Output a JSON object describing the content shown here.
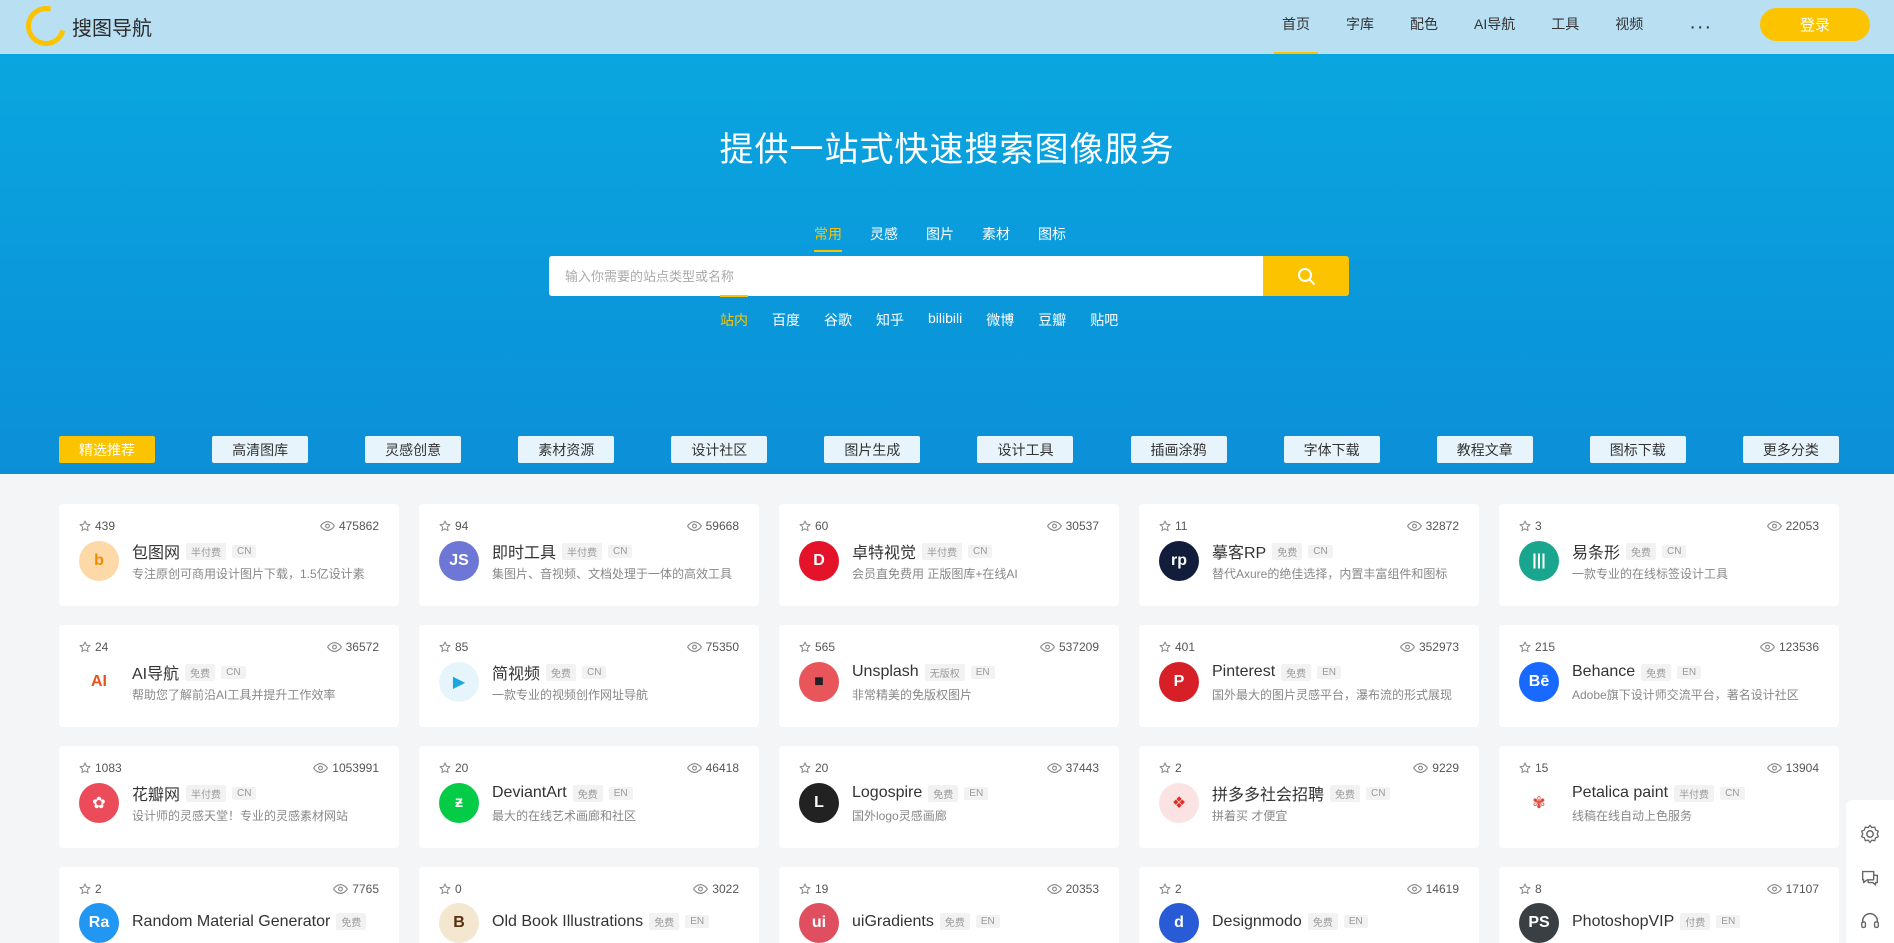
{
  "header": {
    "logo_text": "搜图导航",
    "nav": [
      "首页",
      "字库",
      "配色",
      "AI导航",
      "工具",
      "视频"
    ],
    "more": "···",
    "login": "登录"
  },
  "hero": {
    "title": "提供一站式快速搜索图像服务",
    "search_tabs": [
      "常用",
      "灵感",
      "图片",
      "素材",
      "图标"
    ],
    "search_placeholder": "输入你需要的站点类型或名称",
    "engines": [
      "站内",
      "百度",
      "谷歌",
      "知乎",
      "bilibili",
      "微博",
      "豆瓣",
      "贴吧"
    ]
  },
  "categories": [
    "精选推荐",
    "高清图库",
    "灵感创意",
    "素材资源",
    "设计社区",
    "图片生成",
    "设计工具",
    "插画涂鸦",
    "字体下载",
    "教程文章",
    "图标下载",
    "更多分类"
  ],
  "sites": [
    {
      "stars": "439",
      "views": "475862",
      "name": "包图网",
      "fee": "半付费",
      "lang": "CN",
      "desc": "专注原创可商用设计图片下载，1.5亿设计素",
      "icon": "b",
      "color": "#fdd9a8",
      "fg": "#f08a00"
    },
    {
      "stars": "94",
      "views": "59668",
      "name": "即时工具",
      "fee": "半付费",
      "lang": "CN",
      "desc": "集图片、音视频、文档处理于一体的高效工具",
      "icon": "JS",
      "color": "#6f77d6",
      "fg": "#ffffff"
    },
    {
      "stars": "60",
      "views": "30537",
      "name": "卓特视觉",
      "fee": "半付费",
      "lang": "CN",
      "desc": "会员直免费用 正版图库+在线AI",
      "icon": "D",
      "color": "#e4132a",
      "fg": "#ffffff"
    },
    {
      "stars": "11",
      "views": "32872",
      "name": "摹客RP",
      "fee": "免费",
      "lang": "CN",
      "desc": "替代Axure的绝佳选择，内置丰富组件和图标",
      "icon": "rp",
      "color": "#121c3b",
      "fg": "#ffffff"
    },
    {
      "stars": "3",
      "views": "22053",
      "name": "易条形",
      "fee": "免费",
      "lang": "CN",
      "desc": "一款专业的在线标签设计工具",
      "icon": "|||",
      "color": "#1aa58f",
      "fg": "#ffffff"
    },
    {
      "stars": "24",
      "views": "36572",
      "name": "AI导航",
      "fee": "免费",
      "lang": "CN",
      "desc": "帮助您了解前沿AI工具并提升工作效率",
      "icon": "AI",
      "color": "#ffffff",
      "fg": "#e8541e"
    },
    {
      "stars": "85",
      "views": "75350",
      "name": "简视频",
      "fee": "免费",
      "lang": "CN",
      "desc": "一款专业的视频创作网址导航",
      "icon": "▶",
      "color": "#e6f5fc",
      "fg": "#1aa6e0"
    },
    {
      "stars": "565",
      "views": "537209",
      "name": "Unsplash",
      "fee": "无版权",
      "lang": "EN",
      "desc": "非常精美的免版权图片",
      "icon": "■",
      "color": "#e8555a",
      "fg": "#222222"
    },
    {
      "stars": "401",
      "views": "352973",
      "name": "Pinterest",
      "fee": "免费",
      "lang": "EN",
      "desc": "国外最大的图片灵感平台，瀑布流的形式展现",
      "icon": "P",
      "color": "#d61f26",
      "fg": "#ffffff"
    },
    {
      "stars": "215",
      "views": "123536",
      "name": "Behance",
      "fee": "免费",
      "lang": "EN",
      "desc": "Adobe旗下设计师交流平台，著名设计社区",
      "icon": "Bē",
      "color": "#1769ff",
      "fg": "#ffffff"
    },
    {
      "stars": "1083",
      "views": "1053991",
      "name": "花瓣网",
      "fee": "半付费",
      "lang": "CN",
      "desc": "设计师的灵感天堂！专业的灵感素材网站",
      "icon": "✿",
      "color": "#ec4b5a",
      "fg": "#ffffff"
    },
    {
      "stars": "20",
      "views": "46418",
      "name": "DeviantArt",
      "fee": "免费",
      "lang": "EN",
      "desc": "最大的在线艺术画廊和社区",
      "icon": "ƶ",
      "color": "#05cc47",
      "fg": "#ffffff"
    },
    {
      "stars": "20",
      "views": "37443",
      "name": "Logospire",
      "fee": "免费",
      "lang": "EN",
      "desc": "国外logo灵感画廊",
      "icon": "L",
      "color": "#222222",
      "fg": "#ffffff"
    },
    {
      "stars": "2",
      "views": "9229",
      "name": "拼多多社会招聘",
      "fee": "免费",
      "lang": "CN",
      "desc": "拼着买 才便宜",
      "icon": "❖",
      "color": "#fbe3e3",
      "fg": "#e02e24"
    },
    {
      "stars": "15",
      "views": "13904",
      "name": "Petalica paint",
      "fee": "半付费",
      "lang": "CN",
      "desc": "线稿在线自动上色服务",
      "icon": "✾",
      "color": "#ffffff",
      "fg": "#e24a3b"
    },
    {
      "stars": "2",
      "views": "7765",
      "name": "Random Material Generator",
      "fee": "免费",
      "lang": "",
      "desc": "",
      "icon": "Ra",
      "color": "#2196f3",
      "fg": "#ffffff"
    },
    {
      "stars": "0",
      "views": "3022",
      "name": "Old Book Illustrations",
      "fee": "免费",
      "lang": "EN",
      "desc": "",
      "icon": "B",
      "color": "#f3e7d0",
      "fg": "#5a2e10"
    },
    {
      "stars": "19",
      "views": "20353",
      "name": "uiGradients",
      "fee": "免费",
      "lang": "EN",
      "desc": "",
      "icon": "ui",
      "color": "#e04f5f",
      "fg": "#ffffff"
    },
    {
      "stars": "2",
      "views": "14619",
      "name": "Designmodo",
      "fee": "免费",
      "lang": "EN",
      "desc": "",
      "icon": "d",
      "color": "#2a5bd7",
      "fg": "#ffffff"
    },
    {
      "stars": "8",
      "views": "17107",
      "name": "PhotoshopVIP",
      "fee": "付费",
      "lang": "EN",
      "desc": "",
      "icon": "PS",
      "color": "#3a3f44",
      "fg": "#ffffff"
    }
  ]
}
